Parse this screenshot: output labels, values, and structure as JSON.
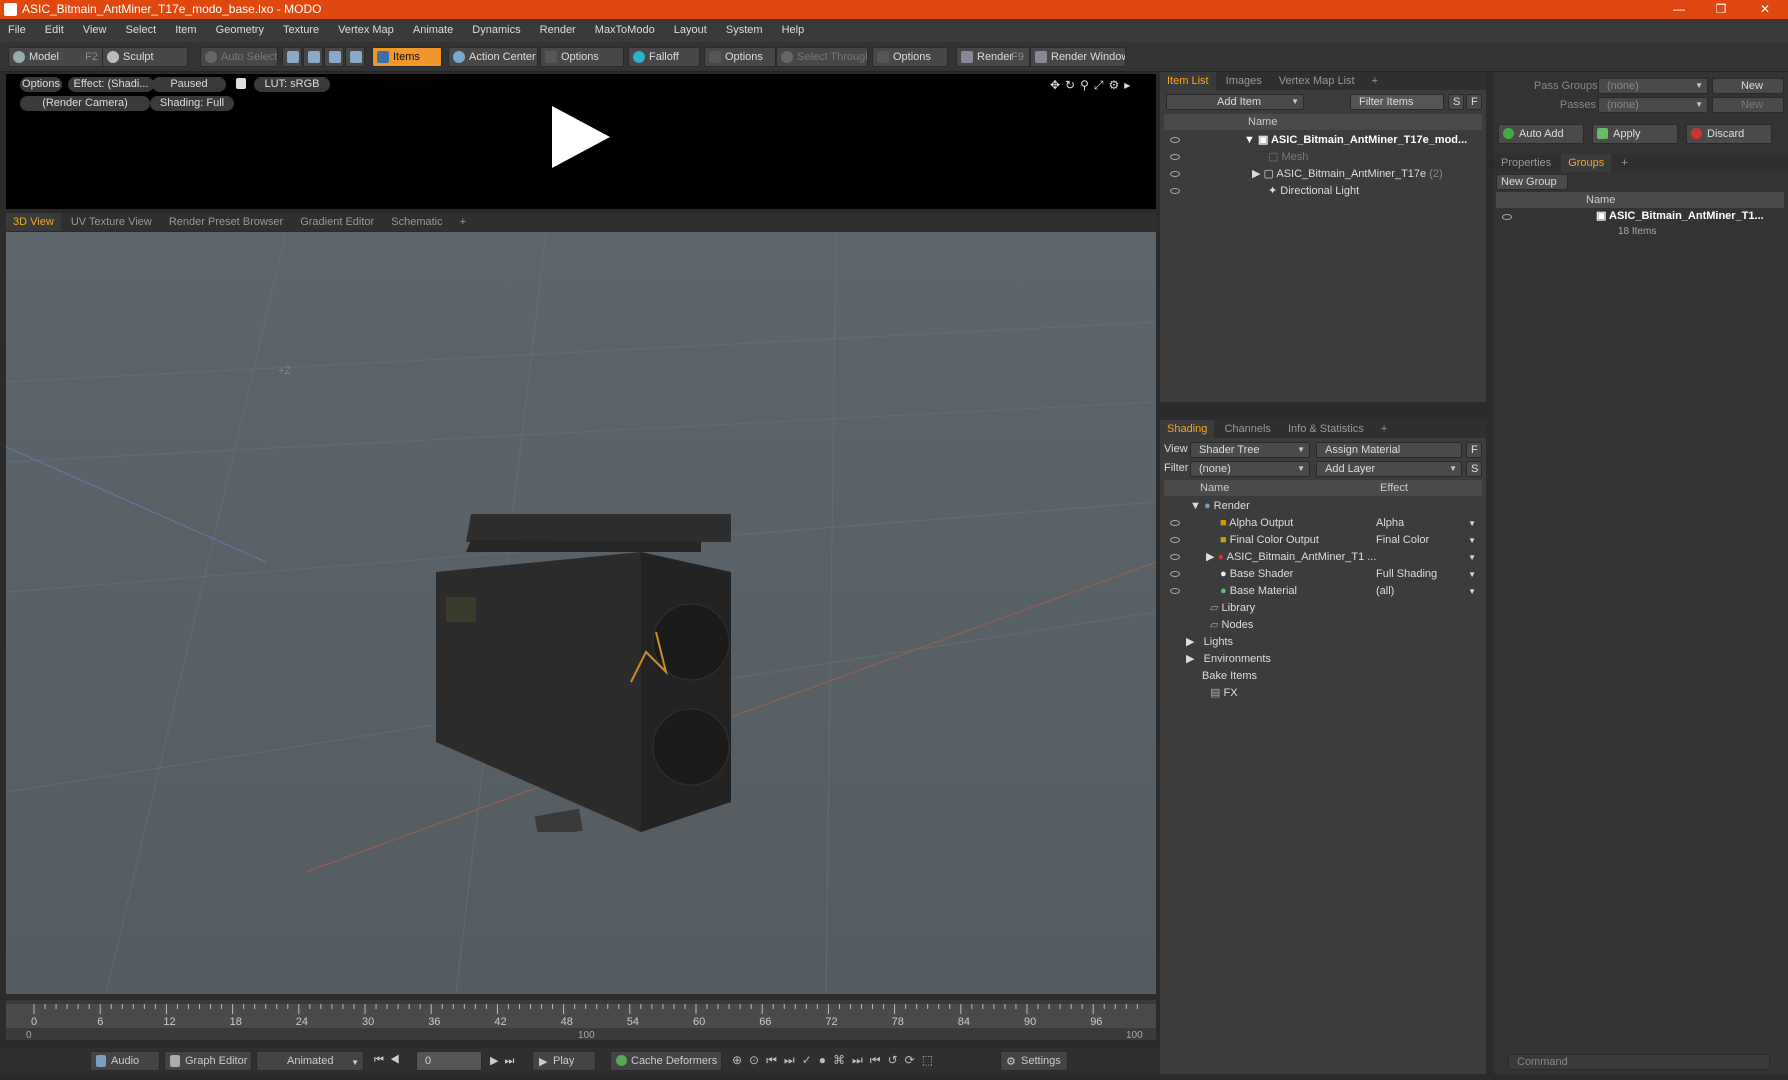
{
  "window": {
    "title": "ASIC_Bitmain_AntMiner_T17e_modo_base.lxo - MODO",
    "controls": [
      "—",
      "❐",
      "✕"
    ]
  },
  "menu": [
    "File",
    "Edit",
    "View",
    "Select",
    "Item",
    "Geometry",
    "Texture",
    "Vertex Map",
    "Animate",
    "Dynamics",
    "Render",
    "MaxToModo",
    "Layout",
    "System",
    "Help"
  ],
  "toolbar": {
    "model": "Model",
    "model_key": "F2",
    "sculpt": "Sculpt",
    "auto_select": "Auto Select",
    "items": "Items",
    "action_center": "Action Center",
    "options1": "Options",
    "falloff": "Falloff",
    "options2": "Options",
    "select_through": "Select Through",
    "options3": "Options",
    "render": "Render",
    "render_key": "F9",
    "render_window": "Render Window"
  },
  "preview": {
    "options": "Options",
    "effect": "Effect: (Shadi...",
    "paused": "Paused",
    "lut": "LUT: sRGB",
    "camera": "(Render Camera)",
    "shading": "Shading: Full"
  },
  "viewport_tabs": [
    "3D View",
    "UV Texture View",
    "Render Preset Browser",
    "Gradient Editor",
    "Schematic",
    "+"
  ],
  "viewport": {
    "axis_label": "+Z"
  },
  "timeline": {
    "ticks": [
      "0",
      "6",
      "12",
      "18",
      "24",
      "30",
      "36",
      "42",
      "48",
      "54",
      "60",
      "66",
      "72",
      "78",
      "84",
      "90",
      "96"
    ],
    "lower": [
      "0",
      "100",
      "100"
    ]
  },
  "bottom": {
    "audio": "Audio",
    "graph_editor": "Graph Editor",
    "animated": "Animated",
    "frame": "0",
    "play": "Play",
    "cache_deformers": "Cache Deformers",
    "settings": "Settings"
  },
  "item_list": {
    "tabs": [
      "Item List",
      "Images",
      "Vertex Map List",
      "+"
    ],
    "add_item": "Add Item",
    "filter_items": "Filter Items",
    "s": "S",
    "f": "F",
    "col_name": "Name",
    "rows": [
      {
        "label": "ASIC_Bitmain_AntMiner_T17e_mod...",
        "bold": true,
        "indent": 0
      },
      {
        "label": "Mesh",
        "dim": true,
        "indent": 1
      },
      {
        "label": "ASIC_Bitmain_AntMiner_T17e",
        "count": "(2)",
        "indent": 1
      },
      {
        "label": "Directional Light",
        "indent": 1
      }
    ]
  },
  "shading": {
    "tabs": [
      "Shading",
      "Channels",
      "Info & Statistics",
      "+"
    ],
    "view_label": "View",
    "view_value": "Shader Tree",
    "assign_material": "Assign Material",
    "f": "F",
    "filter_label": "Filter",
    "filter_value": "(none)",
    "add_layer": "Add Layer",
    "s": "S",
    "col_name": "Name",
    "col_effect": "Effect",
    "rows": [
      {
        "label": "Render",
        "effect": ""
      },
      {
        "label": "Alpha Output",
        "effect": "Alpha"
      },
      {
        "label": "Final Color Output",
        "effect": "Final Color"
      },
      {
        "label": "ASIC_Bitmain_AntMiner_T1 ...",
        "effect": ""
      },
      {
        "label": "Base Shader",
        "effect": "Full Shading"
      },
      {
        "label": "Base Material",
        "effect": "(all)"
      },
      {
        "label": "Library",
        "effect": ""
      },
      {
        "label": "Nodes",
        "effect": ""
      },
      {
        "label": "Lights",
        "effect": ""
      },
      {
        "label": "Environments",
        "effect": ""
      },
      {
        "label": "Bake Items",
        "effect": ""
      },
      {
        "label": "FX",
        "effect": ""
      }
    ]
  },
  "groups": {
    "pass_groups_label": "Pass Groups",
    "pass_groups_value": "(none)",
    "new1": "New",
    "passes_label": "Passes",
    "passes_value": "(none)",
    "new2": "New",
    "auto_add": "Auto Add",
    "apply": "Apply",
    "discard": "Discard",
    "tabs": [
      "Properties",
      "Groups",
      "+"
    ],
    "new_group": "New Group",
    "col_name": "Name",
    "group_name": "ASIC_Bitmain_AntMiner_T1...",
    "group_count": "18 Items",
    "command_placeholder": "Command"
  }
}
